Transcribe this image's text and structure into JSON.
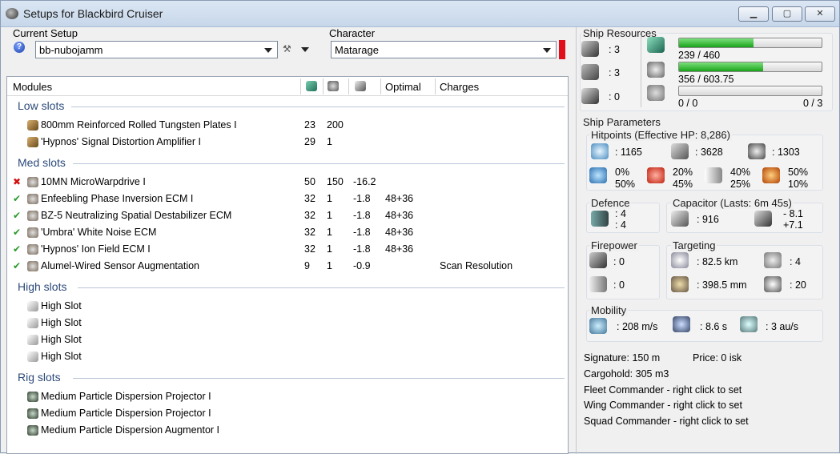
{
  "window": {
    "title": "Setups for Blackbird Cruiser"
  },
  "setup": {
    "label": "Current Setup",
    "value": "bb-nubojamm"
  },
  "character": {
    "label": "Character",
    "value": "Matarage"
  },
  "modules_header": {
    "modules": "Modules",
    "optimal": "Optimal",
    "charges": "Charges"
  },
  "groups": {
    "low": {
      "label": "Low slots",
      "items": [
        {
          "name": "800mm Reinforced Rolled Tungsten Plates I",
          "c1": "23",
          "c2": "200",
          "c3": "",
          "c4": "",
          "c5": ""
        },
        {
          "name": "'Hypnos' Signal Distortion Amplifier I",
          "c1": "29",
          "c2": "1",
          "c3": "",
          "c4": "",
          "c5": ""
        }
      ]
    },
    "med": {
      "label": "Med slots",
      "items": [
        {
          "name": "10MN MicroWarpdrive I",
          "status": "✖",
          "c1": "50",
          "c2": "150",
          "c3": "-16.2",
          "c4": "",
          "c5": ""
        },
        {
          "name": "Enfeebling Phase Inversion ECM I",
          "status": "✔",
          "c1": "32",
          "c2": "1",
          "c3": "-1.8",
          "c4": "48+36",
          "c5": ""
        },
        {
          "name": "BZ-5 Neutralizing Spatial Destabilizer ECM",
          "status": "✔",
          "c1": "32",
          "c2": "1",
          "c3": "-1.8",
          "c4": "48+36",
          "c5": ""
        },
        {
          "name": "'Umbra' White Noise ECM",
          "status": "✔",
          "c1": "32",
          "c2": "1",
          "c3": "-1.8",
          "c4": "48+36",
          "c5": ""
        },
        {
          "name": "'Hypnos' Ion Field ECM I",
          "status": "✔",
          "c1": "32",
          "c2": "1",
          "c3": "-1.8",
          "c4": "48+36",
          "c5": ""
        },
        {
          "name": "Alumel-Wired Sensor Augmentation",
          "status": "✔",
          "c1": "9",
          "c2": "1",
          "c3": "-0.9",
          "c4": "",
          "c5": "Scan Resolution"
        }
      ]
    },
    "high": {
      "label": "High slots",
      "items": [
        {
          "name": "High Slot"
        },
        {
          "name": "High Slot"
        },
        {
          "name": "High Slot"
        },
        {
          "name": "High Slot"
        }
      ]
    },
    "rig": {
      "label": "Rig slots",
      "items": [
        {
          "name": "Medium Particle Dispersion Projector I"
        },
        {
          "name": "Medium Particle Dispersion Projector I"
        },
        {
          "name": "Medium Particle Dispersion Augmentor I"
        }
      ]
    }
  },
  "resources": {
    "title": "Ship Resources",
    "turrets": ": 3",
    "launchers": ": 3",
    "drones": ": 0",
    "cpu": {
      "text": "239 / 460",
      "fraction": 0.52
    },
    "power": {
      "text": "356 / 603.75",
      "fraction": 0.59
    },
    "calibration": {
      "text": "0 / 0",
      "right": "0 / 3",
      "fraction": 0
    }
  },
  "params": {
    "title": "Ship Parameters",
    "hp": {
      "title": "Hitpoints (Effective HP: 8,286)",
      "shield": ": 1165",
      "armor": ": 3628",
      "structure": ": 1303",
      "em": [
        "0%",
        "50%"
      ],
      "thermal": [
        "20%",
        "45%"
      ],
      "kinetic": [
        "40%",
        "25%"
      ],
      "explosive": [
        "50%",
        "10%"
      ]
    },
    "defence": {
      "title": "Defence",
      "a": ": 4",
      "b": ": 4"
    },
    "capacitor": {
      "title": "Capacitor (Lasts: 6m 45s)",
      "cap": ": 916",
      "delta": [
        "- 8.1",
        "+7.1"
      ]
    },
    "firepower": {
      "title": "Firepower",
      "turret": ": 0",
      "missile": ": 0"
    },
    "targeting": {
      "title": "Targeting",
      "range": ": 82.5 km",
      "targets": ": 4",
      "scanres": ": 398.5 mm",
      "sensor": ": 20"
    },
    "mobility": {
      "title": "Mobility",
      "speed": ": 208 m/s",
      "align": ": 8.6 s",
      "warp": ": 3 au/s"
    },
    "signature": "Signature: 150 m",
    "price": "Price: 0 isk",
    "cargo": "Cargohold: 305 m3",
    "fleet": "Fleet Commander - right click to set",
    "wing": "Wing Commander - right click to set",
    "squad": "Squad Commander - right click to set"
  }
}
